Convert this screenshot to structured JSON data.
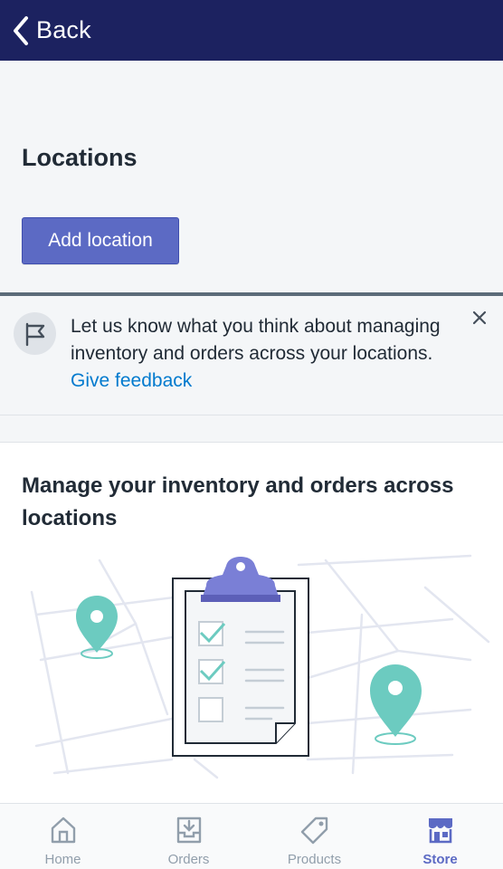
{
  "navbar": {
    "back_label": "Back"
  },
  "page": {
    "title": "Locations",
    "add_button_label": "Add location"
  },
  "banner": {
    "text": "Let us know what you think about managing inventory and orders across your locations.",
    "link_label": "Give feedback"
  },
  "card": {
    "title": "Manage your inventory and orders across locations"
  },
  "tabs": [
    {
      "label": "Home",
      "icon": "home-icon",
      "active": false
    },
    {
      "label": "Orders",
      "icon": "orders-icon",
      "active": false
    },
    {
      "label": "Products",
      "icon": "tag-icon",
      "active": false
    },
    {
      "label": "Store",
      "icon": "store-icon",
      "active": true
    }
  ],
  "colors": {
    "navbar": "#1c2260",
    "primary": "#5c6ac4",
    "link": "#007ace",
    "map_pin": "#6ccbc0",
    "tab_inactive": "#919eab"
  }
}
